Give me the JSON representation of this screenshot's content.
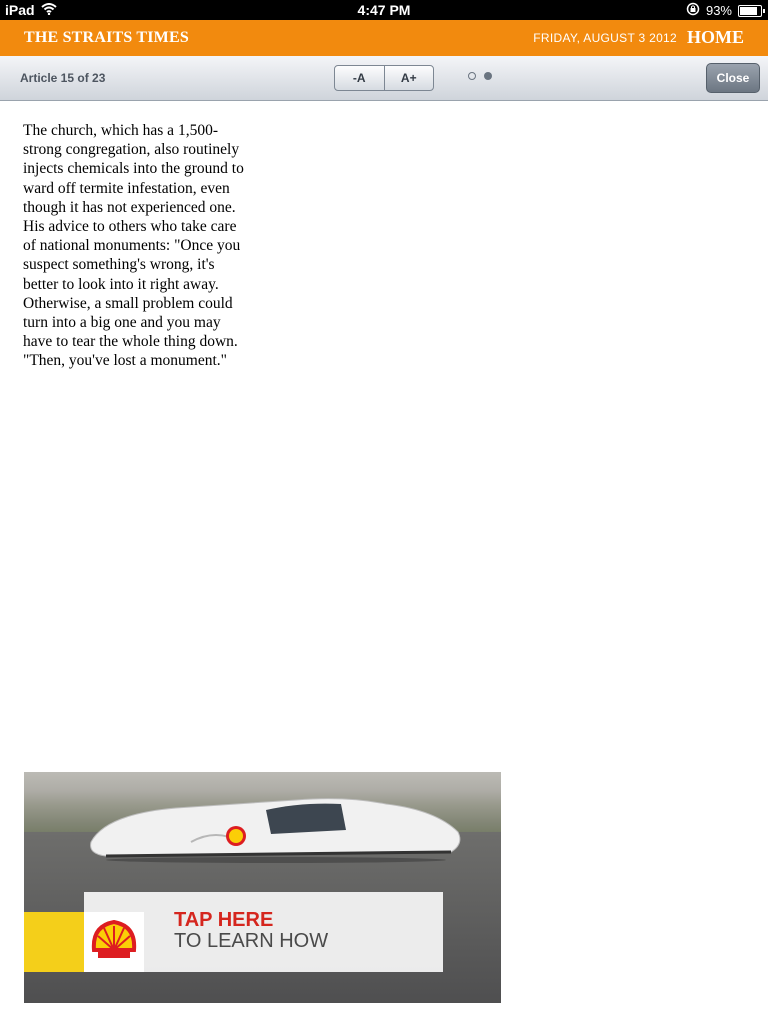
{
  "status_bar": {
    "device": "iPad",
    "time": "4:47 PM",
    "battery": "93%"
  },
  "masthead": {
    "brand": "THE STRAITS TIMES",
    "date": "FRIDAY, AUGUST 3 2012",
    "home_label": "HOME"
  },
  "toolbar": {
    "article_count": "Article 15 of 23",
    "font_decrease": "-A",
    "font_increase": "A+",
    "close_label": "Close",
    "pages": {
      "total": 2,
      "current": 2
    }
  },
  "article": {
    "paragraphs": [
      "The church, which has a 1,500-strong congregation, also routinely injects chemicals into the ground to ward off termite infestation, even though it has not experienced one.",
      " His advice to others who take care of national monuments: \"Once you suspect something's wrong, it's better to look into it right away. Otherwise, a small problem could turn into a big one and you may have to tear the whole thing down.",
      "\"Then, you've lost a monument.\""
    ]
  },
  "ad": {
    "cta_line1": "TAP HERE",
    "cta_line2": "TO LEARN HOW",
    "brand_logo": "shell-logo",
    "colors": {
      "shell_red": "#dd1d21",
      "shell_yellow": "#fbce07",
      "cta_red": "#d5261e"
    }
  },
  "colors": {
    "masthead": "#f28a0e"
  }
}
